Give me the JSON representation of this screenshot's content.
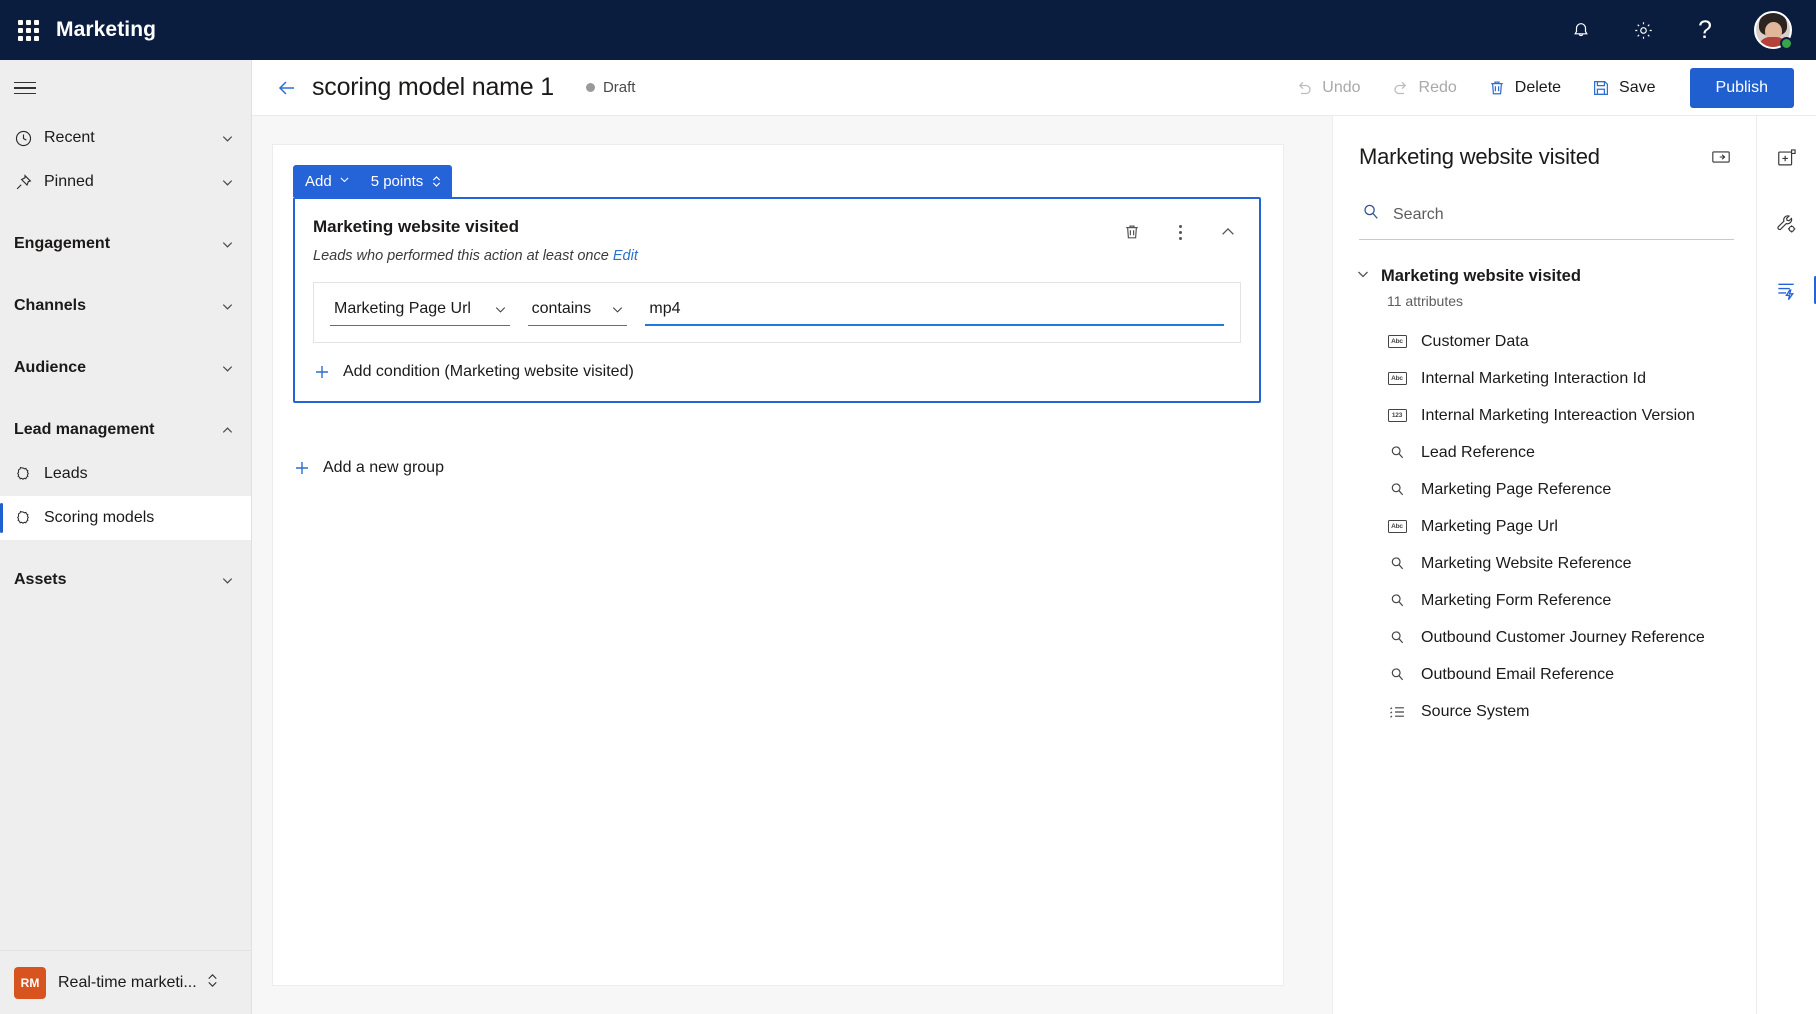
{
  "appbar": {
    "waffle_label": "app-launcher",
    "title": "Marketing",
    "icons": [
      "notification-bell-icon",
      "gear-icon",
      "help-icon"
    ],
    "help_glyph": "?"
  },
  "sidebar": {
    "items": [
      {
        "label": "Recent",
        "icon": "clock-icon",
        "chevron": "down",
        "type": "link"
      },
      {
        "label": "Pinned",
        "icon": "pin-icon",
        "chevron": "down",
        "type": "link"
      },
      {
        "label": "Engagement",
        "icon": "",
        "chevron": "down",
        "type": "group"
      },
      {
        "label": "Channels",
        "icon": "",
        "chevron": "down",
        "type": "group"
      },
      {
        "label": "Audience",
        "icon": "",
        "chevron": "down",
        "type": "group"
      },
      {
        "label": "Lead management",
        "icon": "",
        "chevron": "up",
        "type": "group"
      },
      {
        "label": "Leads",
        "icon": "gear-outline-icon",
        "chevron": "",
        "type": "sub"
      },
      {
        "label": "Scoring models",
        "icon": "gear-outline-icon",
        "chevron": "",
        "type": "sub",
        "selected": true
      },
      {
        "label": "Assets",
        "icon": "",
        "chevron": "down",
        "type": "group"
      }
    ],
    "app_switcher": {
      "badge": "RM",
      "name": "Real-time marketi..."
    }
  },
  "commandbar": {
    "back": "back-arrow",
    "title": "scoring model name 1",
    "status": "Draft",
    "undo_label": "Undo",
    "redo_label": "Redo",
    "delete_label": "Delete",
    "save_label": "Save",
    "publish_label": "Publish"
  },
  "editor": {
    "points_pill": {
      "add_label": "Add",
      "points_label": "5 points"
    },
    "group": {
      "title": "Marketing website visited",
      "subtitle": "Leads who performed this action at least once",
      "edit_link": "Edit",
      "condition": {
        "attribute": "Marketing Page Url",
        "operator": "contains",
        "value": "mp4",
        "value_placeholder": ""
      },
      "add_condition_label": "Add condition (Marketing website visited)"
    },
    "add_group_label": "Add a new group"
  },
  "right_panel": {
    "title": "Marketing website visited",
    "expand_icon": "panel-expand-icon",
    "search_placeholder": "Search",
    "search_value": "",
    "tree": {
      "label": "Marketing website visited",
      "count_label": "11 attributes",
      "attributes": [
        {
          "label": "Customer Data",
          "icon": "text-type-icon",
          "glyph": "Abc"
        },
        {
          "label": "Internal Marketing Interaction Id",
          "icon": "text-type-icon",
          "glyph": "Abc"
        },
        {
          "label": "Internal Marketing Intereaction Version",
          "icon": "number-type-icon",
          "glyph": "123"
        },
        {
          "label": "Lead Reference",
          "icon": "lookup-type-icon",
          "glyph": "search"
        },
        {
          "label": "Marketing Page Reference",
          "icon": "lookup-type-icon",
          "glyph": "search"
        },
        {
          "label": "Marketing Page Url",
          "icon": "text-type-icon",
          "glyph": "Abc"
        },
        {
          "label": "Marketing Website Reference",
          "icon": "lookup-type-icon",
          "glyph": "search"
        },
        {
          "label": "Marketing Form Reference",
          "icon": "lookup-type-icon",
          "glyph": "search"
        },
        {
          "label": "Outbound Customer Journey Reference",
          "icon": "lookup-type-icon",
          "glyph": "search"
        },
        {
          "label": "Outbound Email Reference",
          "icon": "lookup-type-icon",
          "glyph": "search"
        },
        {
          "label": "Source System",
          "icon": "optionset-type-icon",
          "glyph": "list"
        }
      ]
    }
  },
  "rail": {
    "buttons": [
      {
        "name": "add-panel-icon",
        "active": false
      },
      {
        "name": "settings-wrench-icon",
        "active": false
      },
      {
        "name": "trigger-lightning-icon",
        "active": true
      }
    ]
  },
  "colors": {
    "brand_navy": "#0b1d3f",
    "accent_blue": "#2563d9",
    "publish_blue": "#1f5fd0",
    "link_blue": "#2f6fd0",
    "canvas_bg": "#f7f7f7",
    "sidebar_bg": "#eeeeee",
    "presence_green": "#38a34a",
    "app_badge_orange": "#d8541f"
  }
}
